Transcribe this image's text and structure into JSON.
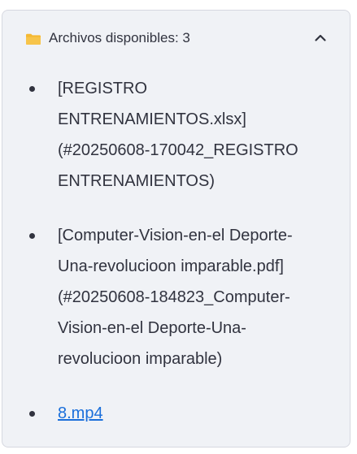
{
  "expander": {
    "icon": "folder-icon",
    "title": "Archivos disponibles: 3",
    "toggle_icon": "chevron-up-icon"
  },
  "files": [
    {
      "lines": [
        "[REGISTRO",
        "ENTRENAMIENTOS.xlsx]",
        "(#20250608-170042_REGISTRO",
        "ENTRENAMIENTOS)"
      ]
    },
    {
      "lines": [
        "[Computer-Vision-en-el Deporte-",
        "Una-revolucioon imparable.pdf]",
        "(#20250608-184823_Computer-",
        "Vision-en-el Deporte-Una-",
        "revolucioon imparable)"
      ]
    },
    {
      "link": "8.mp4"
    }
  ],
  "colors": {
    "panel_background": "#f0f2f6",
    "text": "#31333f",
    "link": "#1a6fdb",
    "folder": "#f5b933"
  }
}
